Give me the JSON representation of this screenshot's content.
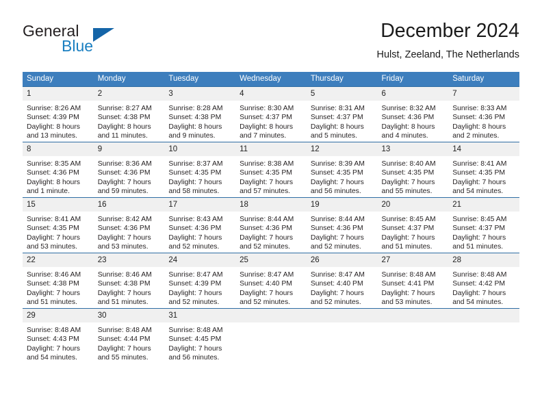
{
  "brand": {
    "name_part1": "General",
    "name_part2": "Blue",
    "flag_icon": "triangle-flag-icon"
  },
  "header": {
    "title": "December 2024",
    "location": "Hulst, Zeeland, The Netherlands"
  },
  "colors": {
    "header_row_bg": "#3d7ebd",
    "row_divider": "#2e6da4",
    "daynum_bg": "#f0f0f0",
    "brand_blue": "#1a7fc1",
    "flag_blue": "#1565a8",
    "text": "#231f20"
  },
  "calendar": {
    "weekday_headers": [
      "Sunday",
      "Monday",
      "Tuesday",
      "Wednesday",
      "Thursday",
      "Friday",
      "Saturday"
    ],
    "weeks": [
      [
        {
          "day": "1",
          "sunrise": "Sunrise: 8:26 AM",
          "sunset": "Sunset: 4:39 PM",
          "daylight_line1": "Daylight: 8 hours",
          "daylight_line2": "and 13 minutes."
        },
        {
          "day": "2",
          "sunrise": "Sunrise: 8:27 AM",
          "sunset": "Sunset: 4:38 PM",
          "daylight_line1": "Daylight: 8 hours",
          "daylight_line2": "and 11 minutes."
        },
        {
          "day": "3",
          "sunrise": "Sunrise: 8:28 AM",
          "sunset": "Sunset: 4:38 PM",
          "daylight_line1": "Daylight: 8 hours",
          "daylight_line2": "and 9 minutes."
        },
        {
          "day": "4",
          "sunrise": "Sunrise: 8:30 AM",
          "sunset": "Sunset: 4:37 PM",
          "daylight_line1": "Daylight: 8 hours",
          "daylight_line2": "and 7 minutes."
        },
        {
          "day": "5",
          "sunrise": "Sunrise: 8:31 AM",
          "sunset": "Sunset: 4:37 PM",
          "daylight_line1": "Daylight: 8 hours",
          "daylight_line2": "and 5 minutes."
        },
        {
          "day": "6",
          "sunrise": "Sunrise: 8:32 AM",
          "sunset": "Sunset: 4:36 PM",
          "daylight_line1": "Daylight: 8 hours",
          "daylight_line2": "and 4 minutes."
        },
        {
          "day": "7",
          "sunrise": "Sunrise: 8:33 AM",
          "sunset": "Sunset: 4:36 PM",
          "daylight_line1": "Daylight: 8 hours",
          "daylight_line2": "and 2 minutes."
        }
      ],
      [
        {
          "day": "8",
          "sunrise": "Sunrise: 8:35 AM",
          "sunset": "Sunset: 4:36 PM",
          "daylight_line1": "Daylight: 8 hours",
          "daylight_line2": "and 1 minute."
        },
        {
          "day": "9",
          "sunrise": "Sunrise: 8:36 AM",
          "sunset": "Sunset: 4:36 PM",
          "daylight_line1": "Daylight: 7 hours",
          "daylight_line2": "and 59 minutes."
        },
        {
          "day": "10",
          "sunrise": "Sunrise: 8:37 AM",
          "sunset": "Sunset: 4:35 PM",
          "daylight_line1": "Daylight: 7 hours",
          "daylight_line2": "and 58 minutes."
        },
        {
          "day": "11",
          "sunrise": "Sunrise: 8:38 AM",
          "sunset": "Sunset: 4:35 PM",
          "daylight_line1": "Daylight: 7 hours",
          "daylight_line2": "and 57 minutes."
        },
        {
          "day": "12",
          "sunrise": "Sunrise: 8:39 AM",
          "sunset": "Sunset: 4:35 PM",
          "daylight_line1": "Daylight: 7 hours",
          "daylight_line2": "and 56 minutes."
        },
        {
          "day": "13",
          "sunrise": "Sunrise: 8:40 AM",
          "sunset": "Sunset: 4:35 PM",
          "daylight_line1": "Daylight: 7 hours",
          "daylight_line2": "and 55 minutes."
        },
        {
          "day": "14",
          "sunrise": "Sunrise: 8:41 AM",
          "sunset": "Sunset: 4:35 PM",
          "daylight_line1": "Daylight: 7 hours",
          "daylight_line2": "and 54 minutes."
        }
      ],
      [
        {
          "day": "15",
          "sunrise": "Sunrise: 8:41 AM",
          "sunset": "Sunset: 4:35 PM",
          "daylight_line1": "Daylight: 7 hours",
          "daylight_line2": "and 53 minutes."
        },
        {
          "day": "16",
          "sunrise": "Sunrise: 8:42 AM",
          "sunset": "Sunset: 4:36 PM",
          "daylight_line1": "Daylight: 7 hours",
          "daylight_line2": "and 53 minutes."
        },
        {
          "day": "17",
          "sunrise": "Sunrise: 8:43 AM",
          "sunset": "Sunset: 4:36 PM",
          "daylight_line1": "Daylight: 7 hours",
          "daylight_line2": "and 52 minutes."
        },
        {
          "day": "18",
          "sunrise": "Sunrise: 8:44 AM",
          "sunset": "Sunset: 4:36 PM",
          "daylight_line1": "Daylight: 7 hours",
          "daylight_line2": "and 52 minutes."
        },
        {
          "day": "19",
          "sunrise": "Sunrise: 8:44 AM",
          "sunset": "Sunset: 4:36 PM",
          "daylight_line1": "Daylight: 7 hours",
          "daylight_line2": "and 52 minutes."
        },
        {
          "day": "20",
          "sunrise": "Sunrise: 8:45 AM",
          "sunset": "Sunset: 4:37 PM",
          "daylight_line1": "Daylight: 7 hours",
          "daylight_line2": "and 51 minutes."
        },
        {
          "day": "21",
          "sunrise": "Sunrise: 8:45 AM",
          "sunset": "Sunset: 4:37 PM",
          "daylight_line1": "Daylight: 7 hours",
          "daylight_line2": "and 51 minutes."
        }
      ],
      [
        {
          "day": "22",
          "sunrise": "Sunrise: 8:46 AM",
          "sunset": "Sunset: 4:38 PM",
          "daylight_line1": "Daylight: 7 hours",
          "daylight_line2": "and 51 minutes."
        },
        {
          "day": "23",
          "sunrise": "Sunrise: 8:46 AM",
          "sunset": "Sunset: 4:38 PM",
          "daylight_line1": "Daylight: 7 hours",
          "daylight_line2": "and 51 minutes."
        },
        {
          "day": "24",
          "sunrise": "Sunrise: 8:47 AM",
          "sunset": "Sunset: 4:39 PM",
          "daylight_line1": "Daylight: 7 hours",
          "daylight_line2": "and 52 minutes."
        },
        {
          "day": "25",
          "sunrise": "Sunrise: 8:47 AM",
          "sunset": "Sunset: 4:40 PM",
          "daylight_line1": "Daylight: 7 hours",
          "daylight_line2": "and 52 minutes."
        },
        {
          "day": "26",
          "sunrise": "Sunrise: 8:47 AM",
          "sunset": "Sunset: 4:40 PM",
          "daylight_line1": "Daylight: 7 hours",
          "daylight_line2": "and 52 minutes."
        },
        {
          "day": "27",
          "sunrise": "Sunrise: 8:48 AM",
          "sunset": "Sunset: 4:41 PM",
          "daylight_line1": "Daylight: 7 hours",
          "daylight_line2": "and 53 minutes."
        },
        {
          "day": "28",
          "sunrise": "Sunrise: 8:48 AM",
          "sunset": "Sunset: 4:42 PM",
          "daylight_line1": "Daylight: 7 hours",
          "daylight_line2": "and 54 minutes."
        }
      ],
      [
        {
          "day": "29",
          "sunrise": "Sunrise: 8:48 AM",
          "sunset": "Sunset: 4:43 PM",
          "daylight_line1": "Daylight: 7 hours",
          "daylight_line2": "and 54 minutes."
        },
        {
          "day": "30",
          "sunrise": "Sunrise: 8:48 AM",
          "sunset": "Sunset: 4:44 PM",
          "daylight_line1": "Daylight: 7 hours",
          "daylight_line2": "and 55 minutes."
        },
        {
          "day": "31",
          "sunrise": "Sunrise: 8:48 AM",
          "sunset": "Sunset: 4:45 PM",
          "daylight_line1": "Daylight: 7 hours",
          "daylight_line2": "and 56 minutes."
        },
        {
          "day": "",
          "sunrise": "",
          "sunset": "",
          "daylight_line1": "",
          "daylight_line2": ""
        },
        {
          "day": "",
          "sunrise": "",
          "sunset": "",
          "daylight_line1": "",
          "daylight_line2": ""
        },
        {
          "day": "",
          "sunrise": "",
          "sunset": "",
          "daylight_line1": "",
          "daylight_line2": ""
        },
        {
          "day": "",
          "sunrise": "",
          "sunset": "",
          "daylight_line1": "",
          "daylight_line2": ""
        }
      ]
    ]
  }
}
